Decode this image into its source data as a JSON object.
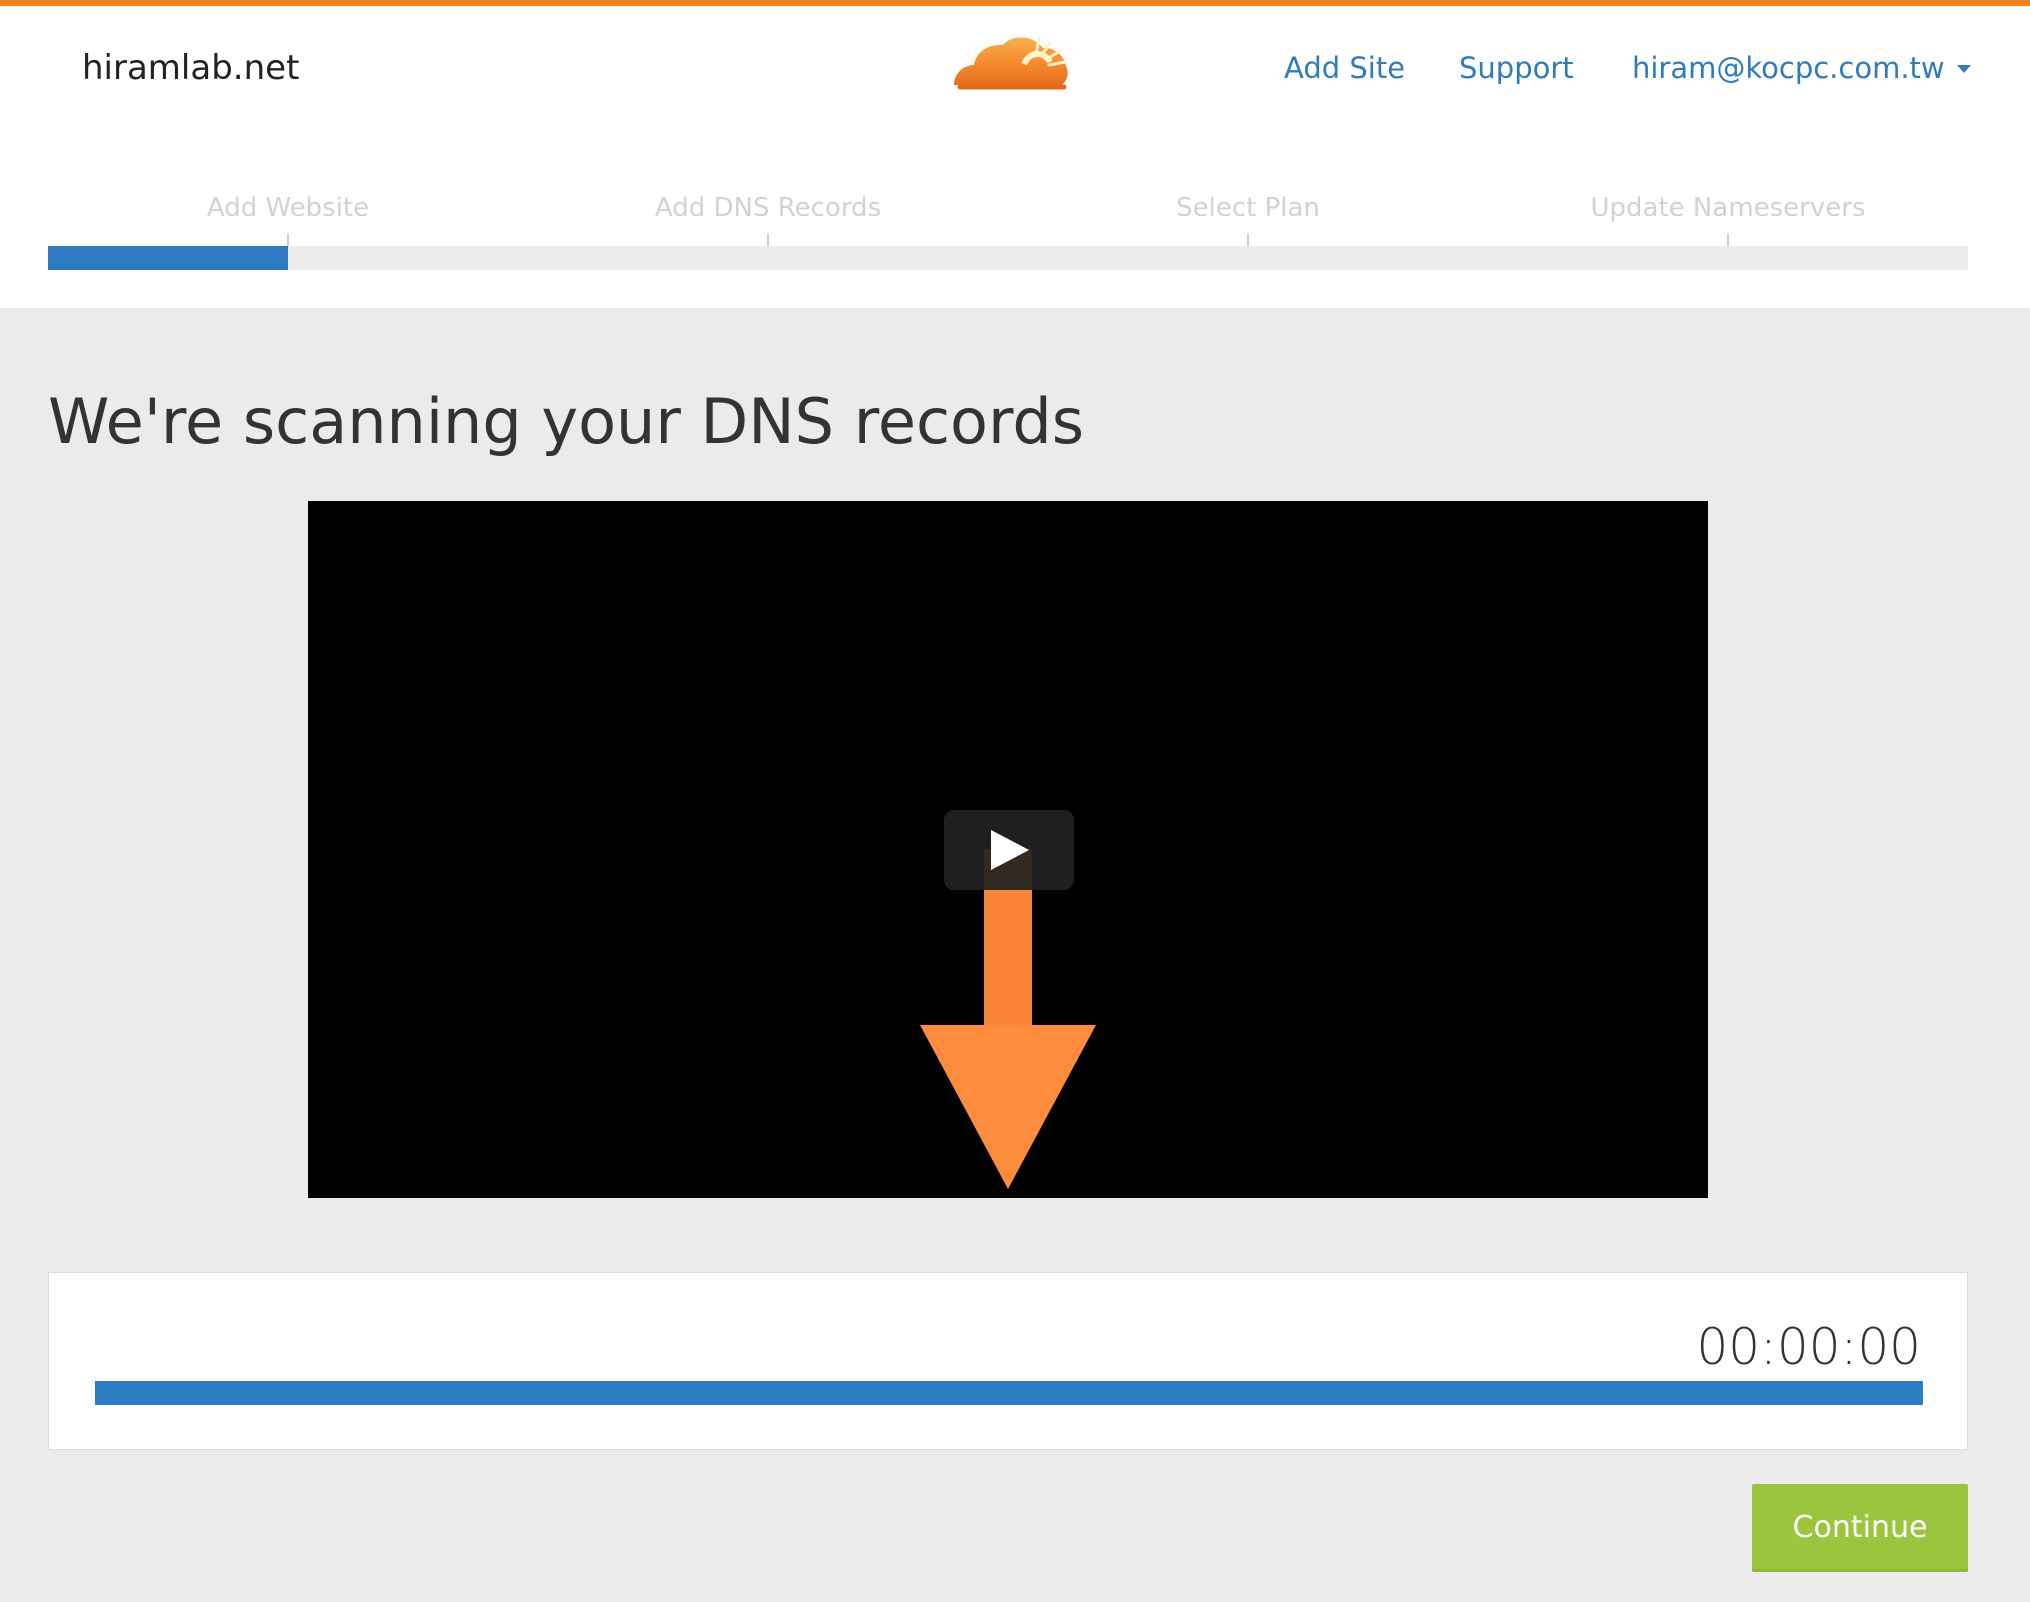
{
  "header": {
    "site_name": "hiramlab.net",
    "logo": "cloudflare-cloud-logo",
    "nav": {
      "add_site": "Add Site",
      "support": "Support",
      "account": "hiram@kocpc.com.tw"
    }
  },
  "steps": {
    "items": [
      "Add Website",
      "Add DNS Records",
      "Select Plan",
      "Update Nameservers"
    ],
    "active_index": 0,
    "progress_fraction": 0.125
  },
  "main": {
    "title": "We're scanning your DNS records",
    "video": {
      "play_icon": "play-icon",
      "arrow_icon": "arrow-down-icon"
    },
    "timer": {
      "value": "00:00:00",
      "progress_fraction": 1.0
    },
    "continue_label": "Continue"
  },
  "colors": {
    "accent": "#f38020",
    "link": "#2f7bbf",
    "progress": "#2d79c2",
    "continue": "#9bc53d"
  }
}
